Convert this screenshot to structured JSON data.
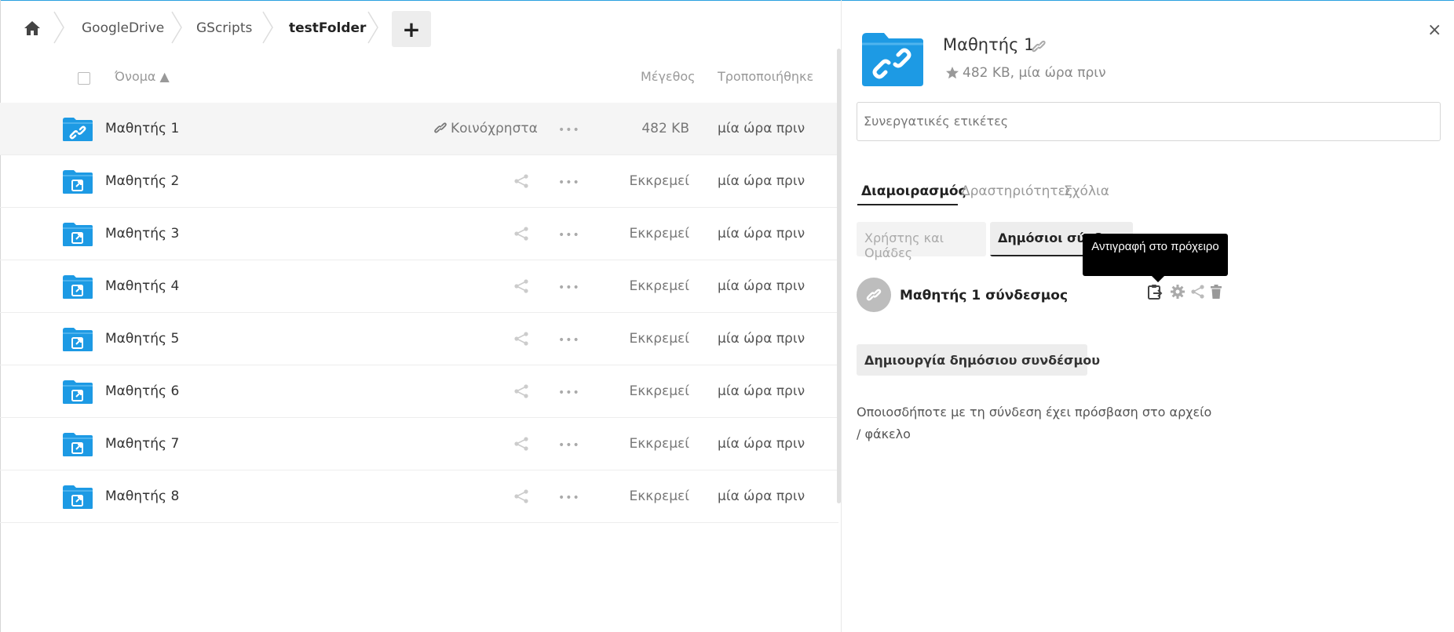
{
  "breadcrumb": {
    "items": [
      "GoogleDrive",
      "GScripts",
      "testFolder"
    ],
    "add_label": "+"
  },
  "list_header": {
    "name": "Όνομα ▲",
    "size": "Μέγεθος",
    "modified": "Τροποποιήθηκε"
  },
  "files": [
    {
      "name": "Μαθητής 1",
      "shared_label": "Κοινόχρηστα",
      "size": "482 KB",
      "modified": "μία ώρα πριν",
      "type": "link"
    },
    {
      "name": "Μαθητής 2",
      "shared_label": "",
      "size": "Εκκρεμεί",
      "modified": "μία ώρα πριν",
      "type": "external"
    },
    {
      "name": "Μαθητής 3",
      "shared_label": "",
      "size": "Εκκρεμεί",
      "modified": "μία ώρα πριν",
      "type": "external"
    },
    {
      "name": "Μαθητής 4",
      "shared_label": "",
      "size": "Εκκρεμεί",
      "modified": "μία ώρα πριν",
      "type": "external"
    },
    {
      "name": "Μαθητής 5",
      "shared_label": "",
      "size": "Εκκρεμεί",
      "modified": "μία ώρα πριν",
      "type": "external"
    },
    {
      "name": "Μαθητής 6",
      "shared_label": "",
      "size": "Εκκρεμεί",
      "modified": "μία ώρα πριν",
      "type": "external"
    },
    {
      "name": "Μαθητής 7",
      "shared_label": "",
      "size": "Εκκρεμεί",
      "modified": "μία ώρα πριν",
      "type": "external"
    },
    {
      "name": "Μαθητής 8",
      "shared_label": "",
      "size": "Εκκρεμεί",
      "modified": "μία ώρα πριν",
      "type": "external"
    }
  ],
  "more_label": "•••",
  "sidebar": {
    "title": "Μαθητής 1",
    "meta": "482 KB, μία ώρα πριν",
    "close_label": "×",
    "tags_placeholder": "Συνεργατικές ετικέτες",
    "tabs": [
      "Διαμοιρασμός",
      "Δραστηριότητες",
      "Σχόλια"
    ],
    "subtabs": [
      "Χρήστης και Ομάδες",
      "Δημόσιοι σύνδεσμοι"
    ],
    "tooltip": "Αντιγραφή στο πρόχειρο",
    "link_name": "Μαθητής 1 σύνδεσμος",
    "create_link_label": "Δημιουργία δημόσιου συνδέσμου",
    "note": "Οποιοσδήποτε με τη σύνδεση έχει πρόσβαση στο αρχείο / φάκελο"
  },
  "colors": {
    "accent": "#2aa0e0",
    "folder": "#1d9ae4"
  }
}
